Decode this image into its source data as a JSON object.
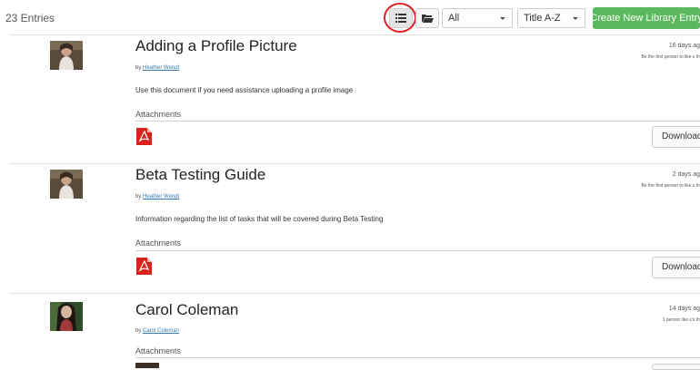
{
  "toolbar": {
    "entries_count": "23 Entries",
    "view_list_icon": "list-view-icon",
    "view_folder_icon": "folder-icon",
    "filter_selected": "All",
    "sort_selected": "Title A-Z",
    "create_label": "Create New Library Entry",
    "annotation_color": "#e0202a",
    "create_color": "#5cb85c"
  },
  "entries": [
    {
      "title": "Adding a Profile Picture",
      "by_prefix": "by",
      "author": "Heather Wendt",
      "description": "Use this document if you need assistance uploading a profile image",
      "attachments_label": "Attachments",
      "date": "16 days ag",
      "likes": "Be the first person to like є́ th",
      "download_label": "Download",
      "attachment_icon": "pdf-icon"
    },
    {
      "title": "Beta Testing Guide",
      "by_prefix": "by",
      "author": "Heather Wendt",
      "description": "Information regarding the list of tasks that will be covered during Beta Testing",
      "attachments_label": "Attachments",
      "date": "2 days ag",
      "likes": "Be the first person to like є́ th",
      "download_label": "Download",
      "attachment_icon": "pdf-icon"
    },
    {
      "title": "Carol Coleman",
      "by_prefix": "by",
      "author": "Carol Coleman",
      "attachments_label": "Attachments",
      "date": "14 days ag",
      "likes": "1 person like є́'s th"
    }
  ]
}
